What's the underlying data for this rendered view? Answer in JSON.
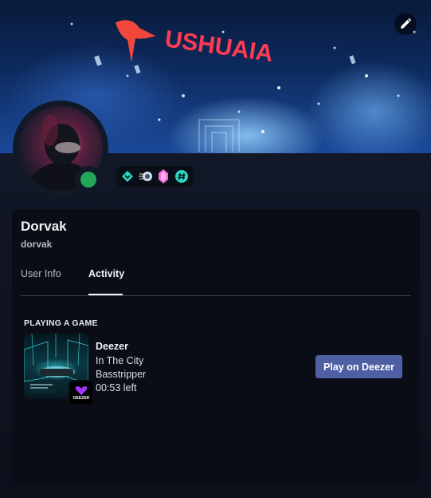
{
  "banner": {
    "sign_text": "USHUAIA"
  },
  "profile": {
    "display_name": "Dorvak",
    "username": "dorvak",
    "status": "online",
    "badges": [
      "hypesquad-icon",
      "nitro-boost-icon",
      "crystal-gem-icon",
      "hashtag-icon"
    ]
  },
  "tabs": [
    {
      "label": "User Info",
      "active": false
    },
    {
      "label": "Activity",
      "active": true
    }
  ],
  "activity": {
    "section_title": "PLAYING A GAME",
    "app_name": "Deezer",
    "track": "In The City",
    "artist": "Basstripper",
    "time_left": "00:53 left",
    "logo_text": "DEEZER",
    "play_button": "Play on Deezer"
  },
  "colors": {
    "accent_button": "#4e5fa3",
    "status_online": "#23a55a",
    "panel_bg": "#0a0d16"
  }
}
